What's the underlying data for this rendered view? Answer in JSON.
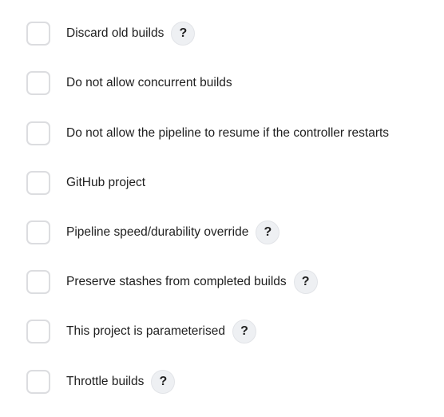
{
  "options": [
    {
      "label": "Discard old builds",
      "checked": false,
      "help": "?"
    },
    {
      "label": "Do not allow concurrent builds",
      "checked": false
    },
    {
      "label": "Do not allow the pipeline to resume if the controller restarts",
      "checked": false
    },
    {
      "label": "GitHub project",
      "checked": false
    },
    {
      "label": "Pipeline speed/durability override",
      "checked": false,
      "help": "?"
    },
    {
      "label": "Preserve stashes from completed builds",
      "checked": false,
      "help": "?"
    },
    {
      "label": "This project is parameterised",
      "checked": false,
      "help": "?"
    },
    {
      "label": "Throttle builds",
      "checked": false,
      "help": "?"
    }
  ]
}
